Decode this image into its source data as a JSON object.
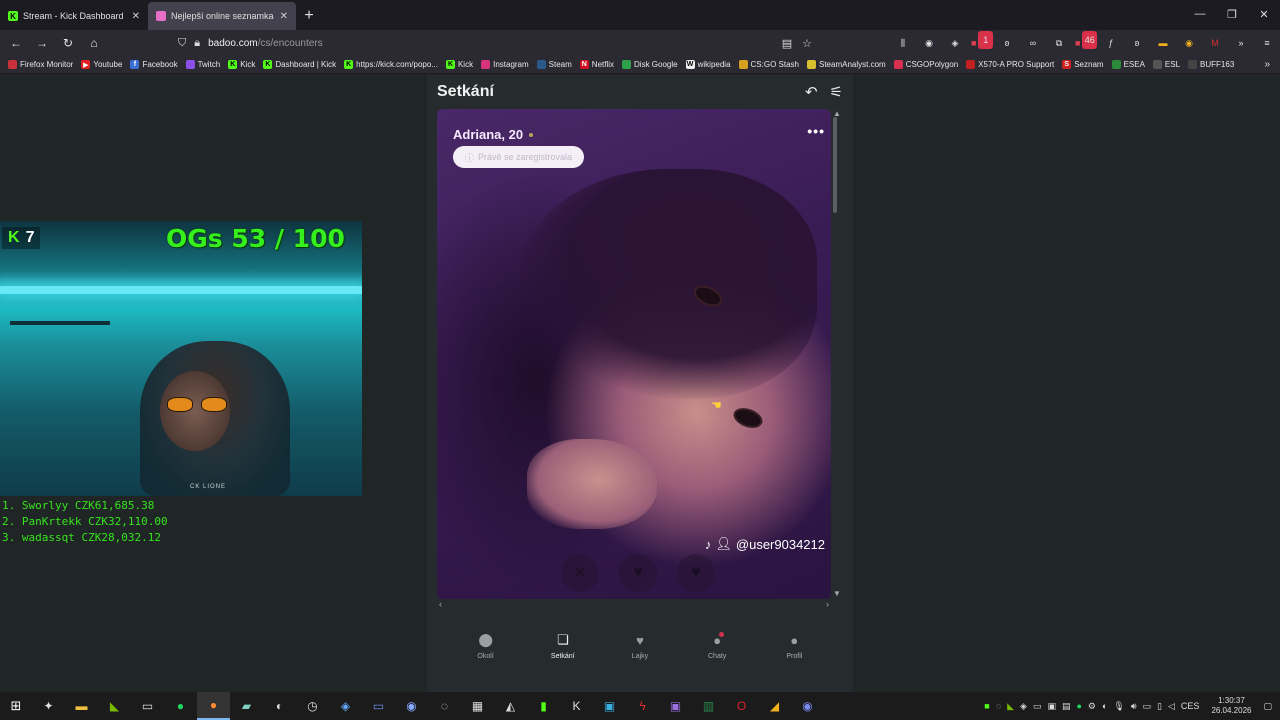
{
  "browser": {
    "tabs": [
      {
        "title": "Stream - Kick Dashboard",
        "favicon": "kick-icon",
        "active": false
      },
      {
        "title": "Nejlepší online seznamka zdarma",
        "favicon": "badoo-icon",
        "active": true
      }
    ],
    "url": {
      "host": "badoo.com",
      "path": "/cs/encounters"
    },
    "bookmarks": [
      "Firefox Monitor",
      "Youtube",
      "Facebook",
      "Twitch",
      "Kick",
      "Dashboard | Kick",
      "https://kick.com/popo...",
      "Kick",
      "Instagram",
      "Steam",
      "Netflix",
      "Disk Google",
      "wikipedia",
      "CS:GO Stash",
      "SteamAnalyst.com",
      "CSGOPolygon",
      "X570-A PRO Support",
      "Seznam",
      "ESEA",
      "ESL",
      "BUFF163"
    ],
    "extension_badges": {
      "first": "1",
      "second": "46"
    }
  },
  "badoo": {
    "header_title": "Setkání",
    "profile": {
      "name_age": "Adriana, 20",
      "registration_badge": "Právě se zaregistrovala",
      "watermark": "@user9034212"
    },
    "bottom_nav": [
      {
        "label": "Okolí",
        "icon": "location-pin-icon"
      },
      {
        "label": "Setkání",
        "icon": "cards-icon"
      },
      {
        "label": "Lajky",
        "icon": "heart-icon"
      },
      {
        "label": "Chaty",
        "icon": "chat-icon"
      },
      {
        "label": "Profil",
        "icon": "person-icon"
      }
    ]
  },
  "stream_overlay": {
    "viewer_count": "7",
    "ogs_label": "OGs 53 / 100",
    "shirt_text": "CK LIONE",
    "leaderboard": [
      "1. Sworlyy CZK61,685.38",
      "2. PanKrtekk CZK32,110.00",
      "3. wadassqt CZK28,032.12"
    ]
  },
  "taskbar": {
    "language": "CES",
    "time": "1:30:37",
    "date": "26.04.2026"
  },
  "colors": {
    "kick_green": "#53fc18",
    "overlay_green": "#35f01c",
    "badge_red": "#d9314a"
  }
}
